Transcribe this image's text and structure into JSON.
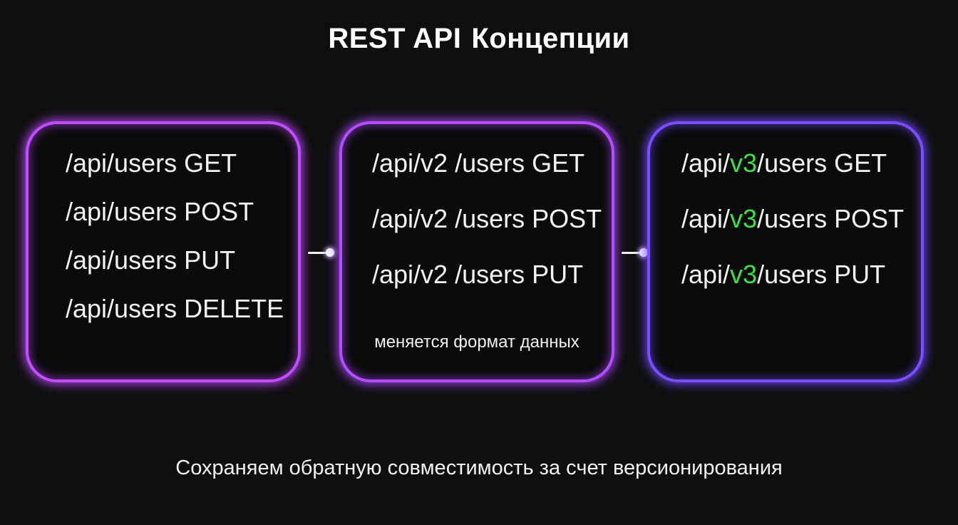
{
  "title": {
    "part1": "REST API",
    "part2": "Концепции"
  },
  "boxes": [
    {
      "endpoints": [
        "/api/users GET",
        "/api/users POST",
        "/api/users PUT",
        "/api/users DELETE"
      ]
    },
    {
      "endpoints": [
        "/api/v2 /users GET",
        "/api/v2 /users POST",
        "/api/v2 /users PUT"
      ],
      "note": "меняется формат данных"
    },
    {
      "prefix": "/api/",
      "version": "v3",
      "suffixes": [
        "/users GET",
        "/users POST",
        "/users PUT"
      ]
    }
  ],
  "footer": "Сохраняем обратную совместимость за счет версионирования",
  "colors": {
    "box1_border": "#c24dff",
    "box2_border": "#b44cff",
    "box3_border": "#7a4dff",
    "version_highlight": "#3ee04a",
    "background": "#0f0f10"
  }
}
